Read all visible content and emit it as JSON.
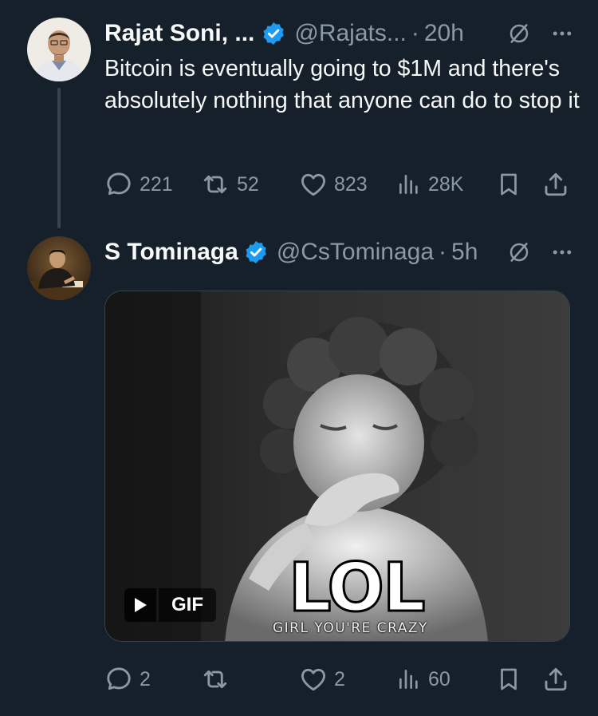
{
  "tweets": [
    {
      "author_name": "Rajat Soni, ...",
      "handle": "@Rajats...",
      "separator": "·",
      "time": "20h",
      "text": "Bitcoin is eventually going to $1M and there's absolutely nothing that anyone can do to stop it",
      "stats": {
        "replies": "221",
        "reposts": "52",
        "likes": "823",
        "views": "28K"
      }
    },
    {
      "author_name": "S Tominaga",
      "handle": "@CsTominaga",
      "separator": "·",
      "time": "5h",
      "media": {
        "badge_label": "GIF",
        "overlay_title": "LOL",
        "overlay_caption": "GIRL YOU'RE CRAZY"
      },
      "stats": {
        "replies": "2",
        "reposts": "",
        "likes": "2",
        "views": "60"
      }
    }
  ],
  "colors": {
    "background": "#15202b",
    "text_primary": "#f7f9f9",
    "text_secondary": "#8b98a5",
    "verified": "#1d9bf0",
    "thread_line": "#38444d"
  },
  "icons": {
    "reply": "reply-icon",
    "repost": "repost-icon",
    "like": "heart-icon",
    "views": "analytics-icon",
    "bookmark": "bookmark-icon",
    "share": "share-icon",
    "verified": "verified-badge-icon",
    "grok": "grok-icon",
    "more": "more-dots-icon",
    "play": "play-icon"
  }
}
